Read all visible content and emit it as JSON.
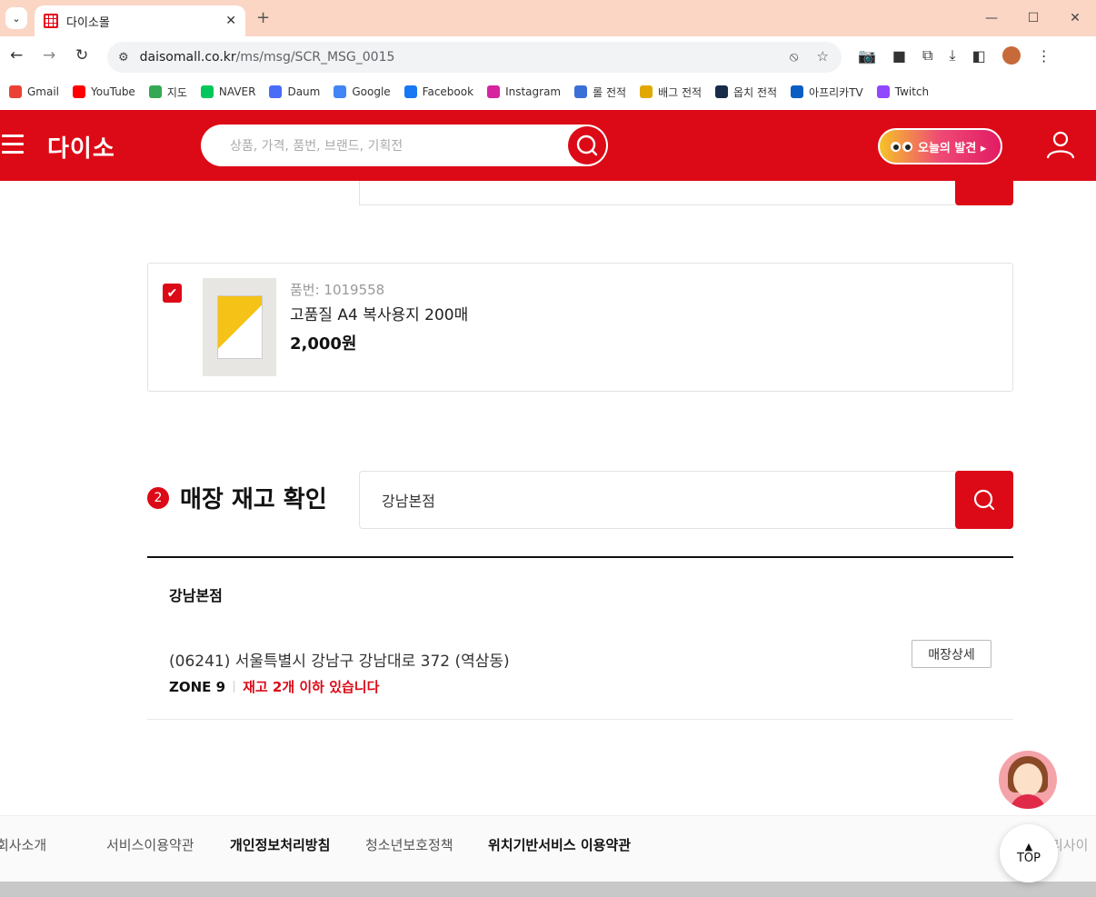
{
  "browser": {
    "tab_title": "다이소몰",
    "url_host": "daisomall.co.kr",
    "url_path": "/ms/msg/SCR_MSG_0015"
  },
  "bookmarks": [
    {
      "label": "Gmail",
      "color": "#ea4335"
    },
    {
      "label": "YouTube",
      "color": "#ff0000"
    },
    {
      "label": "지도",
      "color": "#34a853"
    },
    {
      "label": "NAVER",
      "color": "#03c75a"
    },
    {
      "label": "Daum",
      "color": "#4a6cf7"
    },
    {
      "label": "Google",
      "color": "#4285f4"
    },
    {
      "label": "Facebook",
      "color": "#1877f2"
    },
    {
      "label": "Instagram",
      "color": "#d6249f"
    },
    {
      "label": "롤 전적",
      "color": "#3a6fd8"
    },
    {
      "label": "배그 전적",
      "color": "#e0a800"
    },
    {
      "label": "옵치 전적",
      "color": "#1a2b4a"
    },
    {
      "label": "아프리카TV",
      "color": "#0a5dc2"
    },
    {
      "label": "Twitch",
      "color": "#9146ff"
    }
  ],
  "header": {
    "logo": "다이소",
    "search_placeholder": "상품, 가격, 품번, 브랜드, 기획전",
    "today_label": "오늘의 발견 ▸",
    "brand_color": "#dc0a16"
  },
  "product": {
    "number_label": "품번: 1019558",
    "name": "고품질 A4 복사용지 200매",
    "price": "2,000원",
    "checked": true
  },
  "stock_section": {
    "badge": "2",
    "title": "매장 재고 확인",
    "search_value": "강남본점",
    "store": {
      "name": "강남본점",
      "address": "(06241) 서울특별시 강남구 강남대로 372 (역삼동)",
      "zone": "ZONE 9",
      "stock": "재고 2개 이하 있습니다",
      "detail_button": "매장상세"
    }
  },
  "footer": {
    "links": [
      "회사소개",
      "서비스이용약관",
      "개인정보처리방침",
      "청소년보호정책",
      "위치기반서비스 이용약관",
      "리사이"
    ]
  },
  "top_button": "TOP"
}
